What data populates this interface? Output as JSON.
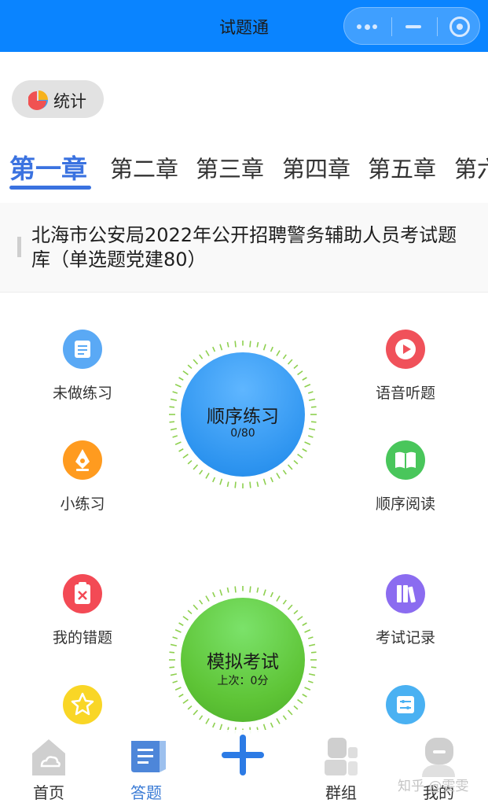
{
  "header": {
    "title": "试题通"
  },
  "stats": {
    "label": "统计"
  },
  "chapter_tabs": [
    {
      "label": "第一章",
      "active": true
    },
    {
      "label": "第二章",
      "active": false
    },
    {
      "label": "第三章",
      "active": false
    },
    {
      "label": "第四章",
      "active": false
    },
    {
      "label": "第五章",
      "active": false
    },
    {
      "label": "第六章",
      "active": false
    }
  ],
  "question_bank": {
    "title": "北海市公安局2022年公开招聘警务辅助人员考试题库（单选题党建80）"
  },
  "features": {
    "unanswered": {
      "label": "未做练习",
      "icon": "scroll-icon",
      "color": "#5aa9f5"
    },
    "audio": {
      "label": "语音听题",
      "icon": "play-icon",
      "color": "#f0515a"
    },
    "mini_practice": {
      "label": "小练习",
      "icon": "pen-nib-icon",
      "color": "#ff9b1f"
    },
    "sequential_reading": {
      "label": "顺序阅读",
      "icon": "book-icon",
      "color": "#49c65b"
    },
    "wrong_questions": {
      "label": "我的错题",
      "icon": "error-clipboard-icon",
      "color": "#f34a55"
    },
    "exam_records": {
      "label": "考试记录",
      "icon": "books-icon",
      "color": "#8b6cf0"
    },
    "favorites": {
      "label": "",
      "icon": "star-icon",
      "color": "#f9d626"
    },
    "settings": {
      "label": "",
      "icon": "sliders-icon",
      "color": "#4ab1f2"
    }
  },
  "sequential_practice": {
    "title": "顺序练习",
    "progress": "0/80",
    "color": "#2f95f0"
  },
  "mock_exam": {
    "title": "模拟考试",
    "last_score": "上次：0分",
    "color": "#5ec436"
  },
  "tabbar": [
    {
      "label": "首页",
      "icon": "home-cloud-icon",
      "active": false
    },
    {
      "label": "答题",
      "icon": "answer-doc-icon",
      "active": true
    },
    {
      "label": "",
      "icon": "plus-icon",
      "active": false
    },
    {
      "label": "群组",
      "icon": "group-icon",
      "active": false
    },
    {
      "label": "我的",
      "icon": "profile-icon",
      "active": false
    }
  ],
  "watermark": "知乎 @雯雯"
}
